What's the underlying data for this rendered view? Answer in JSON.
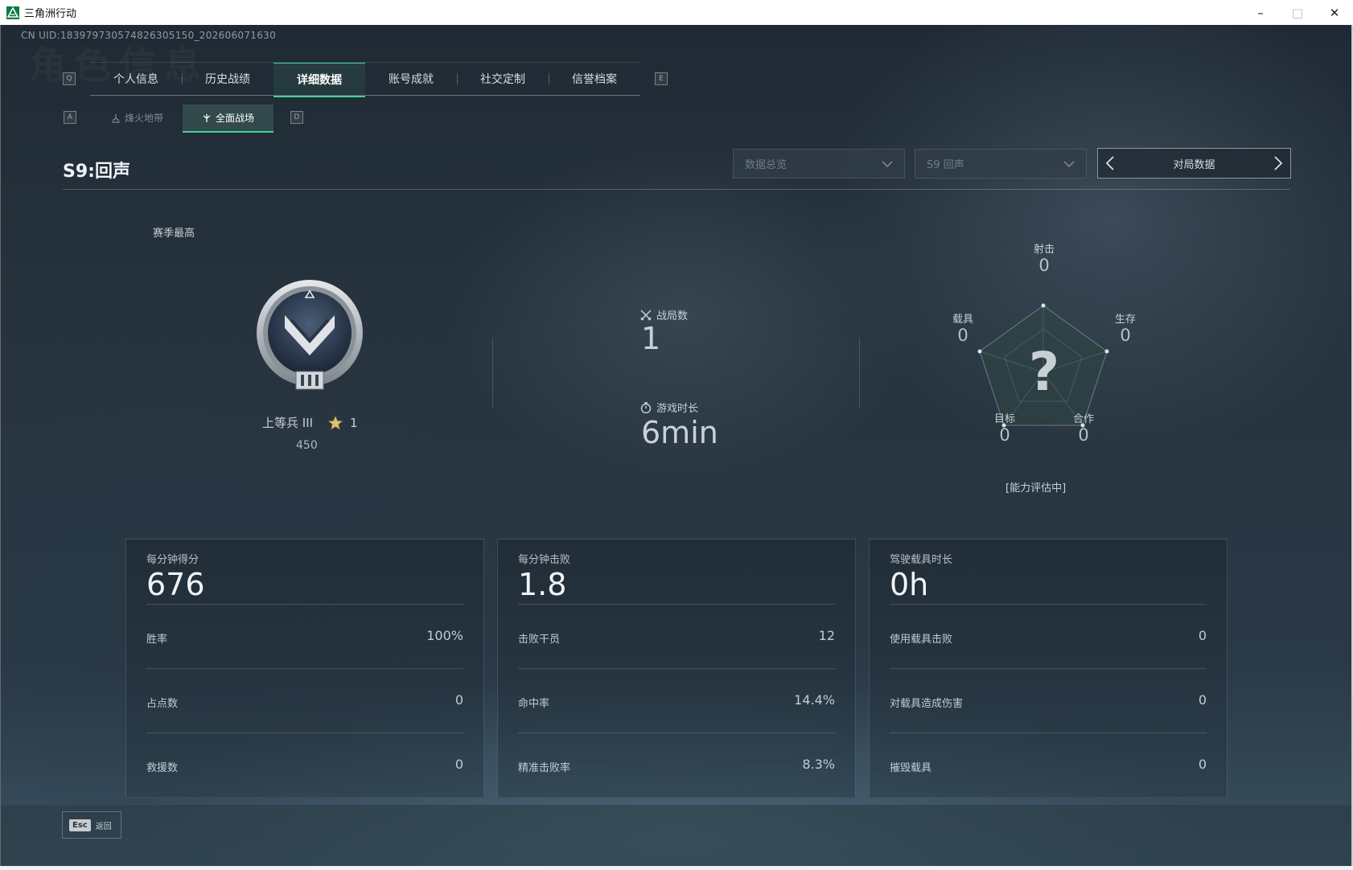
{
  "window": {
    "title": "三角洲行动",
    "minimize_icon": "minimize-icon",
    "maximize_icon": "maximize-icon",
    "close_icon": "close-icon"
  },
  "uid_text": "CN UID:1839797305748263051​50_202606071630",
  "ghost_title": "角色信息",
  "nav": {
    "prev_key": "Q",
    "next_key": "E",
    "tabs": [
      "个人信息",
      "历史战绩",
      "详细数据",
      "账号成就",
      "社交定制",
      "信誉档案"
    ],
    "active_tab": "详细数据"
  },
  "subnav": {
    "prev_key": "A",
    "next_key": "D",
    "tabs": [
      "烽火地带",
      "全面战场"
    ],
    "active_tab": "全面战场"
  },
  "section": {
    "title": "S9:回声",
    "dropdown_1": "数据总览",
    "dropdown_2": "S9 回声",
    "pager_label": "对局数据"
  },
  "rank": {
    "heading": "赛季最高",
    "name": "上等兵 III",
    "stars": "1",
    "score": "450"
  },
  "matches": {
    "label": "战局数",
    "value": "1"
  },
  "playtime": {
    "label": "游戏时长",
    "value": "6min"
  },
  "radar": {
    "center_mark": "?",
    "axes": [
      {
        "label": "射击",
        "value": "0"
      },
      {
        "label": "生存",
        "value": "0"
      },
      {
        "label": "合作",
        "value": "0"
      },
      {
        "label": "目标",
        "value": "0"
      },
      {
        "label": "载具",
        "value": "0"
      }
    ],
    "note": "[能力评估中]"
  },
  "cards": [
    {
      "title": "每分钟得分",
      "value": "676",
      "rows": [
        {
          "label": "胜率",
          "value": "100%"
        },
        {
          "label": "占点数",
          "value": "0"
        },
        {
          "label": "救援数",
          "value": "0"
        }
      ]
    },
    {
      "title": "每分钟击败",
      "value": "1.8",
      "rows": [
        {
          "label": "击败干员",
          "value": "12"
        },
        {
          "label": "命中率",
          "value": "14.4%"
        },
        {
          "label": "精准击败率",
          "value": "8.3%"
        }
      ]
    },
    {
      "title": "驾驶载具时长",
      "value": "0h",
      "rows": [
        {
          "label": "使用载具击败",
          "value": "0"
        },
        {
          "label": "对载具造成伤害",
          "value": "0"
        },
        {
          "label": "摧毁载具",
          "value": "0"
        }
      ]
    }
  ],
  "footer": {
    "esc_key": "Esc",
    "esc_label": "返回"
  },
  "colors": {
    "accent": "#42d39a",
    "background": "#1f2a34",
    "text": "#cfd6dc"
  }
}
